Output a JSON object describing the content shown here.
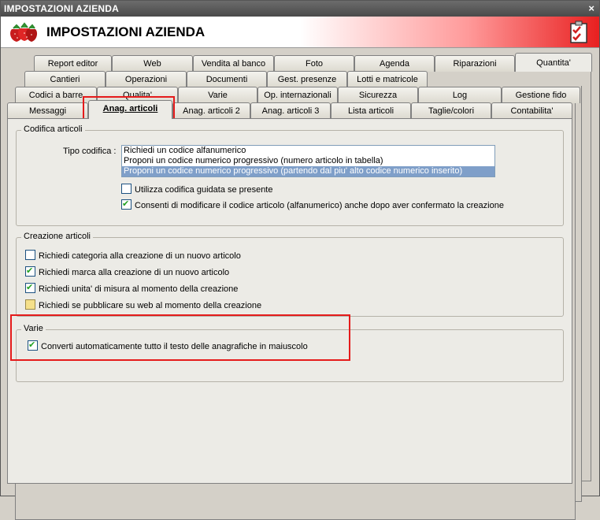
{
  "window": {
    "title": "IMPOSTAZIONI AZIENDA",
    "close_label": "×"
  },
  "header": {
    "title": "IMPOSTAZIONI AZIENDA",
    "logo_icon": "strawberry-icon",
    "check_icon": "checklist-icon"
  },
  "tabs": {
    "row1": [
      "Report editor",
      "Web",
      "Vendita al banco",
      "Foto",
      "Agenda",
      "Riparazioni",
      "Quantita'"
    ],
    "row2": [
      "Cantieri",
      "Operazioni",
      "Documenti",
      "Gest. presenze",
      "Lotti e matricole"
    ],
    "row3": [
      "Codici a barre",
      "Qualita'",
      "Varie",
      "Op. internazionali",
      "Sicurezza",
      "Log",
      "Gestione fido"
    ],
    "row4": [
      "Messaggi",
      "Anag. articoli",
      "Anag. articoli 2",
      "Anag. articoli 3",
      "Lista articoli",
      "Taglie/colori",
      "Contabilita'"
    ],
    "active": "Anag. articoli"
  },
  "codifica": {
    "title": "Codifica articoli",
    "tipo_label": "Tipo codifica :",
    "options": [
      "Richiedi un codice alfanumerico",
      "Proponi un codice numerico progressivo (numero articolo in tabella)",
      "Proponi un codice numerico progressivo (partendo dal piu' alto codice numerico inserito)"
    ],
    "selected_index": 2,
    "cb_guidata": {
      "label": "Utilizza codifica guidata se presente",
      "checked": false
    },
    "cb_modifica": {
      "label": "Consenti di modificare il codice articolo (alfanumerico) anche dopo aver confermato la creazione",
      "checked": true
    }
  },
  "creazione": {
    "title": "Creazione articoli",
    "items": [
      {
        "label": "Richiedi categoria alla creazione di un nuovo articolo",
        "checked": false
      },
      {
        "label": "Richiedi marca alla creazione di un nuovo articolo",
        "checked": true
      },
      {
        "label": "Richiedi unita' di misura al momento della creazione",
        "checked": true
      },
      {
        "label": "Richiedi se pubblicare su web al momento della creazione",
        "checked": false
      }
    ]
  },
  "varie": {
    "title": "Varie",
    "cb_maiuscolo": {
      "label": "Converti automaticamente tutto il testo delle anagrafiche in maiuscolo",
      "checked": true
    }
  }
}
